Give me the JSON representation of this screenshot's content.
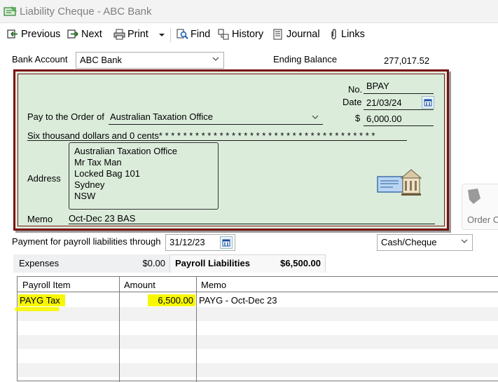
{
  "window": {
    "title": "Liability Cheque - ABC Bank"
  },
  "toolbar": {
    "previous": "Previous",
    "next": "Next",
    "print": "Print",
    "find": "Find",
    "history": "History",
    "journal": "Journal",
    "links": "Links"
  },
  "account": {
    "bank_account_label": "Bank Account",
    "bank_account_value": "ABC Bank",
    "ending_balance_label": "Ending Balance",
    "ending_balance_value": "277,017.52"
  },
  "cheque": {
    "no_label": "No.",
    "no_value": "BPAY",
    "date_label": "Date",
    "date_value": "21/03/24",
    "pay_to_label": "Pay to the Order of",
    "pay_to_value": "Australian Taxation Office",
    "dollar_sign": "$",
    "amount_value": "6,000.00",
    "amount_words": "Six thousand  dollars and 0 cents* * * * * * * * * * * * * * * * * * * * * * * * * * * * * * * * * * * *",
    "address_label": "Address",
    "address_lines": [
      "Australian Taxation Office",
      "Mr Tax Man",
      "Locked Bag 101",
      "Sydney",
      "NSW"
    ],
    "memo_label": "Memo",
    "memo_value": "Oct-Dec 23 BAS"
  },
  "payment": {
    "through_label": "Payment for payroll liabilities through",
    "through_date": "31/12/23",
    "method_value": "Cash/Cheque"
  },
  "side_card": {
    "label": "Order C"
  },
  "tabs": [
    {
      "label": "Expenses",
      "amount": "$0.00"
    },
    {
      "label": "Payroll Liabilities",
      "amount": "$6,500.00"
    }
  ],
  "table": {
    "headers": [
      "Payroll Item",
      "Amount",
      "Memo"
    ],
    "rows": [
      {
        "item": "PAYG Tax",
        "amount": "6,500.00",
        "memo": "PAYG - Oct-Dec 23"
      }
    ]
  },
  "colors": {
    "cheque_background": "#dbecdb",
    "cheque_border": "#7b0f0f",
    "highlight": "#f7f700"
  }
}
